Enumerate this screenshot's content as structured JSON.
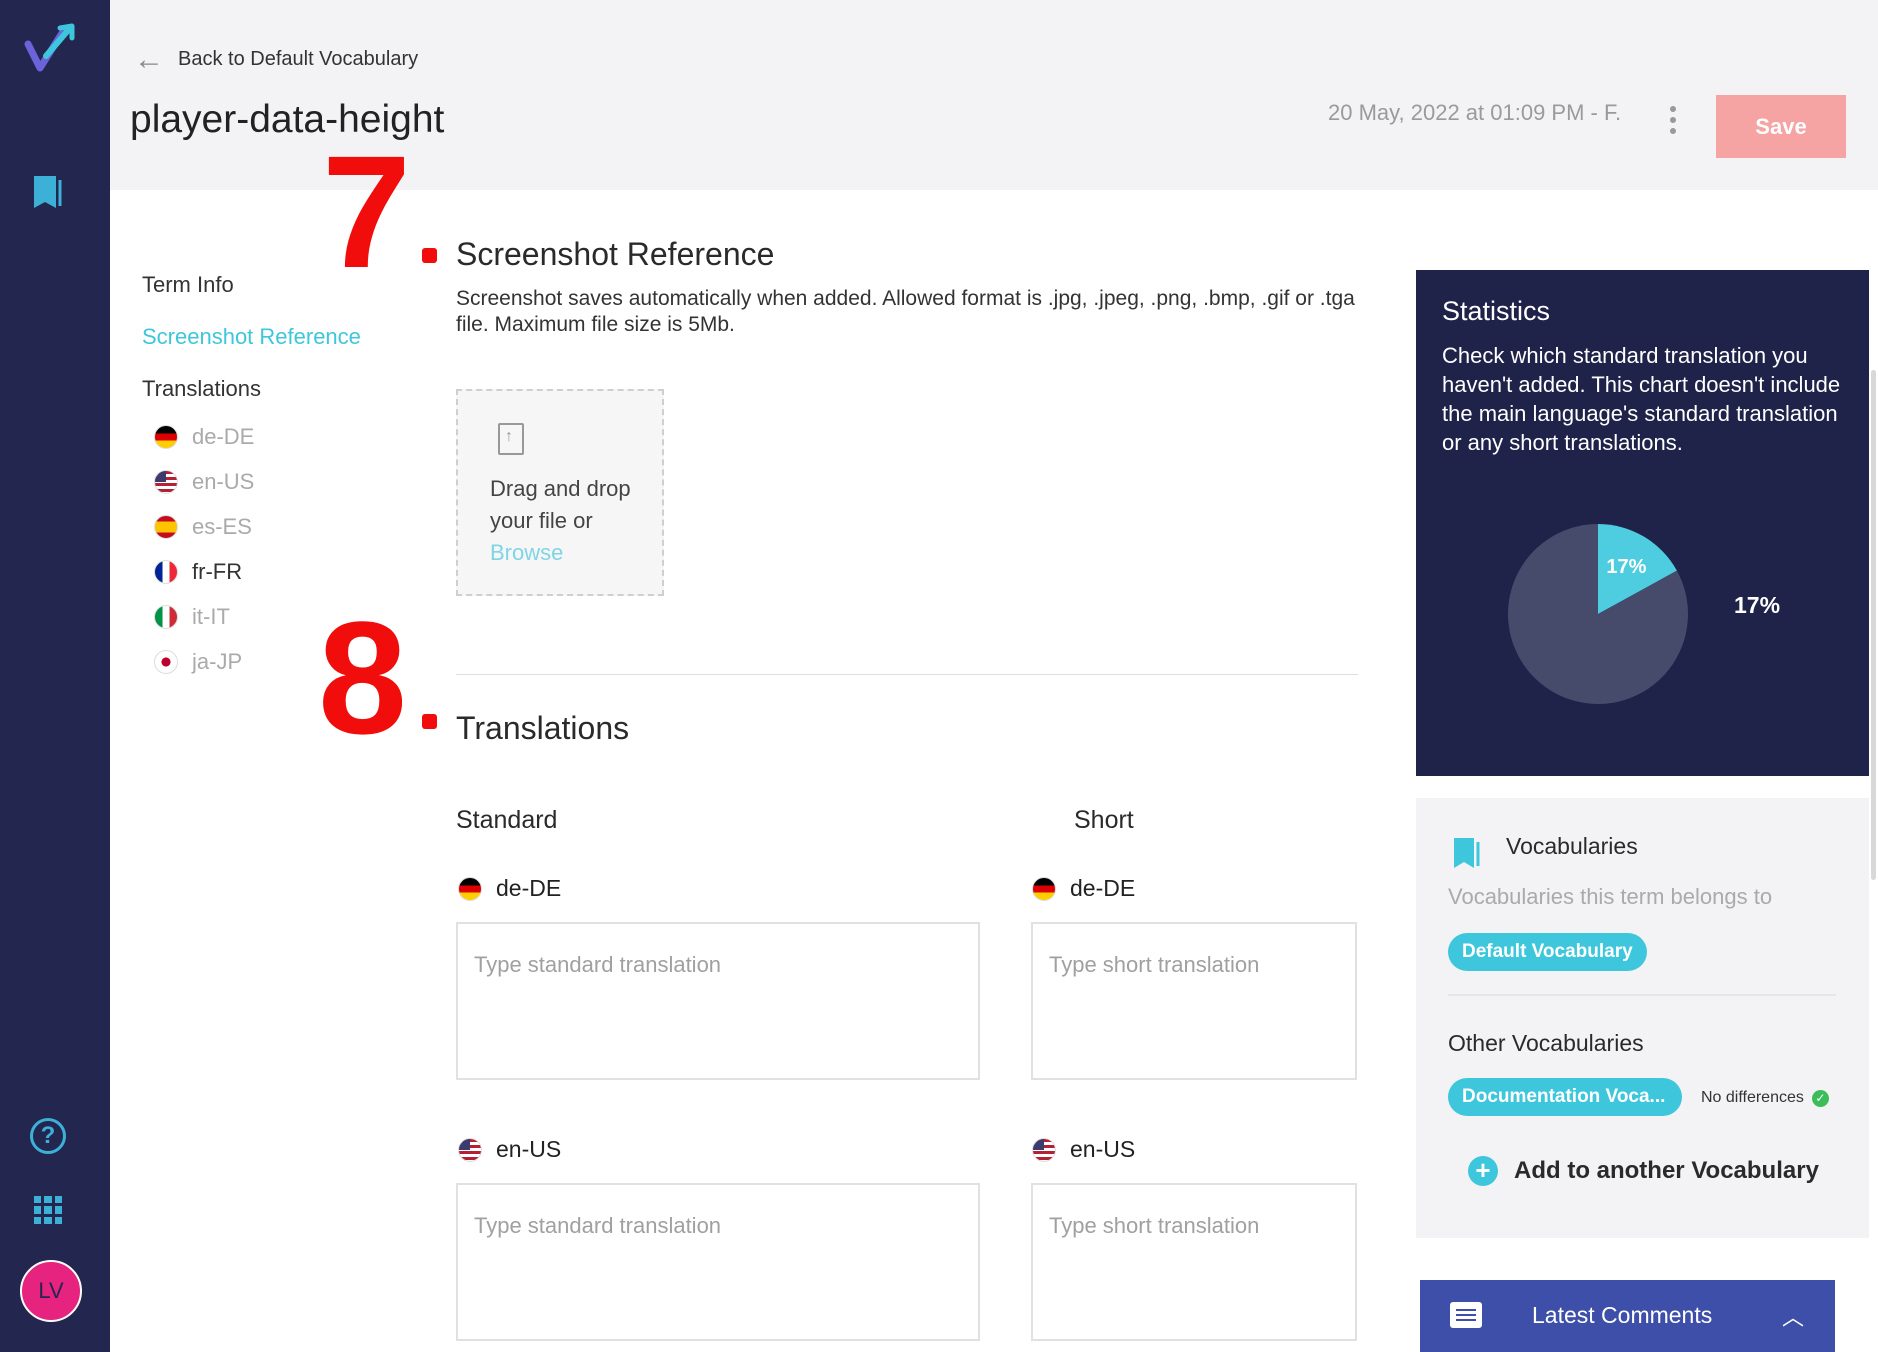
{
  "header": {
    "back_label": "Back to Default Vocabulary",
    "title": "player-data-height",
    "timestamp": "20 May, 2022 at 01:09 PM - F.",
    "save_label": "Save"
  },
  "leftnav": {
    "term_info": "Term Info",
    "screenshot_reference": "Screenshot Reference",
    "translations": "Translations",
    "languages": [
      {
        "code": "de-DE",
        "flag": "flag-de"
      },
      {
        "code": "en-US",
        "flag": "flag-us"
      },
      {
        "code": "es-ES",
        "flag": "flag-es"
      },
      {
        "code": "fr-FR",
        "flag": "flag-fr"
      },
      {
        "code": "it-IT",
        "flag": "flag-it"
      },
      {
        "code": "ja-JP",
        "flag": "flag-jp"
      }
    ]
  },
  "annotations": {
    "seven": "7",
    "eight": "8"
  },
  "screenshot": {
    "title": "Screenshot Reference",
    "description": "Screenshot saves automatically when added. Allowed format is .jpg, .jpeg, .png, .bmp, .gif or .tga file. Maximum file size is 5Mb.",
    "drop_text": "Drag and drop your file or",
    "browse_label": "Browse"
  },
  "translations": {
    "title": "Translations",
    "standard_label": "Standard",
    "short_label": "Short",
    "standard_placeholder": "Type standard translation",
    "short_placeholder": "Type short translation",
    "rows": [
      {
        "lang": "de-DE",
        "flag": "flag-de"
      },
      {
        "lang": "en-US",
        "flag": "flag-us"
      }
    ]
  },
  "statistics": {
    "title": "Statistics",
    "description": "Check which standard translation you haven't added. This chart doesn't include the main language's standard translation or any short translations.",
    "slice_label": "17%",
    "outside_label": "17%"
  },
  "chart_data": {
    "type": "pie",
    "values": [
      17,
      83
    ],
    "labels": [
      "17%",
      ""
    ],
    "colors": [
      "#4fcde0",
      "#474b6b"
    ]
  },
  "vocabularies": {
    "title": "Vocabularies",
    "description": "Vocabularies this term belongs to",
    "current": "Default Vocabulary",
    "other_title": "Other Vocabularies",
    "other_chip": "Documentation Voca...",
    "no_differences": "No differences",
    "add_label": "Add to another Vocabulary"
  },
  "comments": {
    "label": "Latest Comments"
  },
  "colors": {
    "accent": "#3ec7dc",
    "rail": "#23264f",
    "save": "#f6a3a3",
    "annotation": "#f20d0d"
  }
}
